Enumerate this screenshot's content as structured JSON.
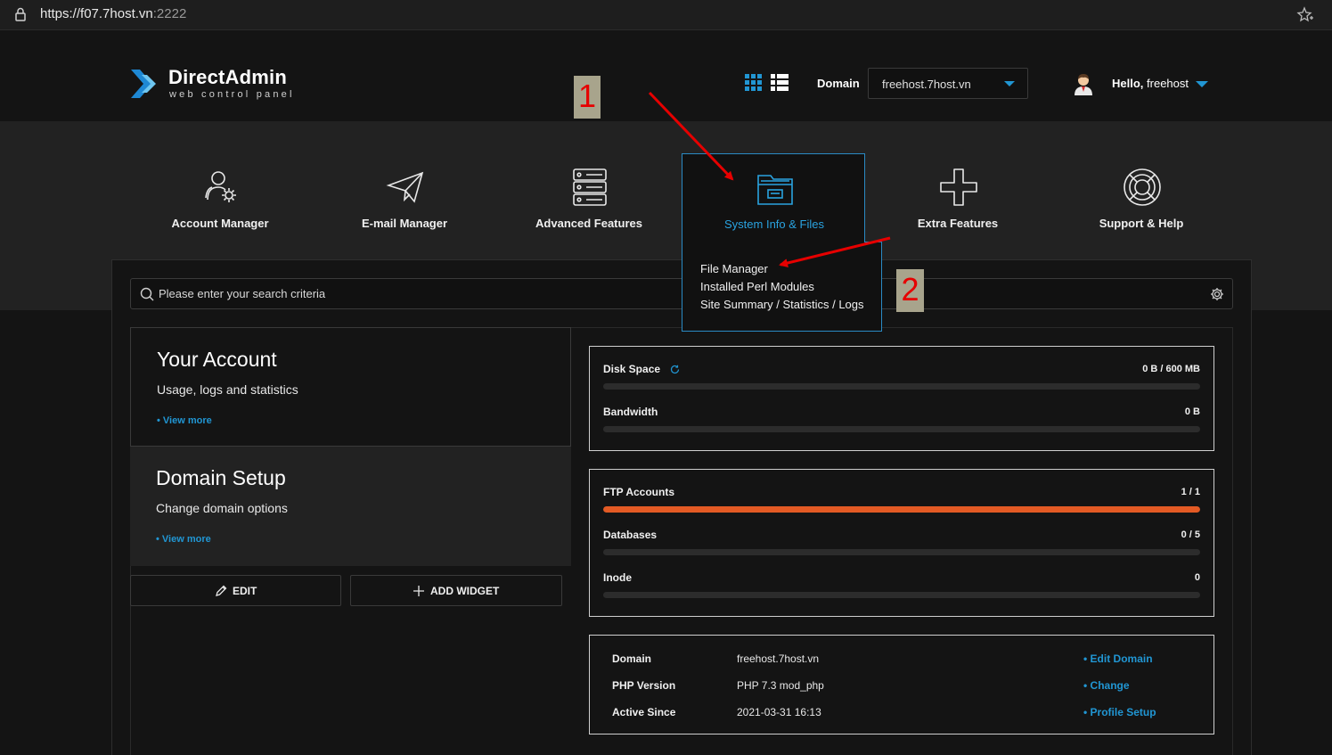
{
  "browser": {
    "url_main": "https://f07.7host.vn",
    "url_port": ":2222"
  },
  "header": {
    "logo_title": "DirectAdmin",
    "logo_subtitle": "web control panel",
    "domain_label": "Domain",
    "domain_value": "freehost.7host.vn",
    "greeting": "Hello,",
    "username": "freehost"
  },
  "nav": [
    {
      "label": "Account Manager",
      "icon": "users-gear-icon"
    },
    {
      "label": "E-mail Manager",
      "icon": "paper-plane-icon"
    },
    {
      "label": "Advanced Features",
      "icon": "server-stack-icon"
    },
    {
      "label": "System Info & Files",
      "icon": "folder-icon",
      "active": true
    },
    {
      "label": "Extra Features",
      "icon": "plus-icon"
    },
    {
      "label": "Support & Help",
      "icon": "lifebuoy-icon"
    }
  ],
  "dropdown": {
    "items": [
      "File Manager",
      "Installed Perl Modules",
      "Site Summary / Statistics / Logs"
    ]
  },
  "search": {
    "placeholder": "Please enter your search criteria"
  },
  "cards": {
    "account": {
      "title": "Your Account",
      "subtitle": "Usage, logs and statistics",
      "link": "• View more"
    },
    "domain": {
      "title": "Domain Setup",
      "subtitle": "Change domain options",
      "link": "• View more"
    }
  },
  "buttons": {
    "edit": "EDIT",
    "add_widget": "ADD WIDGET"
  },
  "usage": {
    "disk_label": "Disk Space",
    "disk_value": "0 B / 600 MB",
    "disk_fraction": 0,
    "bandwidth_label": "Bandwidth",
    "bandwidth_value": "0 B",
    "bandwidth_fraction": 0,
    "ftp_label": "FTP Accounts",
    "ftp_value": "1 / 1",
    "ftp_fraction": 1,
    "db_label": "Databases",
    "db_value": "0 / 5",
    "db_fraction": 0,
    "inode_label": "Inode",
    "inode_value": "0",
    "inode_fraction": 0
  },
  "info": {
    "rows": [
      {
        "key": "Domain",
        "value": "freehost.7host.vn",
        "action": "• Edit Domain"
      },
      {
        "key": "PHP Version",
        "value": "PHP 7.3 mod_php",
        "action": "• Change"
      },
      {
        "key": "Active Since",
        "value": "2021-03-31 16:13",
        "action": "• Profile Setup"
      }
    ]
  },
  "annotations": {
    "step1": "1",
    "step2": "2"
  },
  "colors": {
    "accent": "#2196d3",
    "progress_fill": "#e35a24",
    "annotation_red": "#e60000"
  }
}
